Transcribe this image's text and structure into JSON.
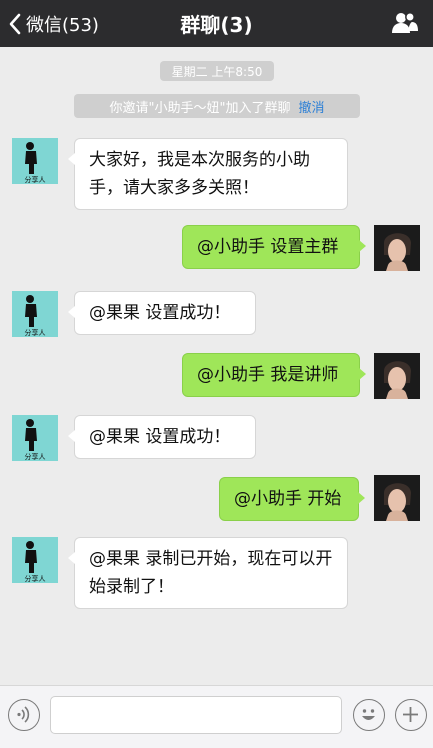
{
  "header": {
    "back_label": "微信(53)",
    "title": "群聊(3)",
    "members_icon": "group-members-icon"
  },
  "chat": {
    "timestamp": "星期二 上午8:50",
    "system_notice": "你邀请\"小助手～妞\"加入了群聊",
    "system_action": "撤消",
    "avatar_caption": "分享人",
    "messages": [
      {
        "side": "left",
        "text": "大家好，我是本次服务的小助手，请大家多多关照！"
      },
      {
        "side": "right",
        "text": "@小助手 设置主群"
      },
      {
        "side": "left",
        "text": "@果果 设置成功！"
      },
      {
        "side": "right",
        "text": "@小助手 我是讲师"
      },
      {
        "side": "left",
        "text": "@果果 设置成功！"
      },
      {
        "side": "right",
        "text": "@小助手 开始"
      },
      {
        "side": "left",
        "text": "@果果 录制已开始，现在可以开始录制了！"
      }
    ]
  },
  "toolbar": {
    "voice_icon": "voice-icon",
    "emoji_icon": "emoji-icon",
    "plus_icon": "plus-icon",
    "input_value": ""
  },
  "colors": {
    "header_bg": "#2c2c2e",
    "chat_bg": "#ececec",
    "bubble_right": "#9fe659",
    "bubble_left": "#ffffff",
    "link": "#2b7fd6",
    "agent_avatar": "#7fd6d3"
  }
}
